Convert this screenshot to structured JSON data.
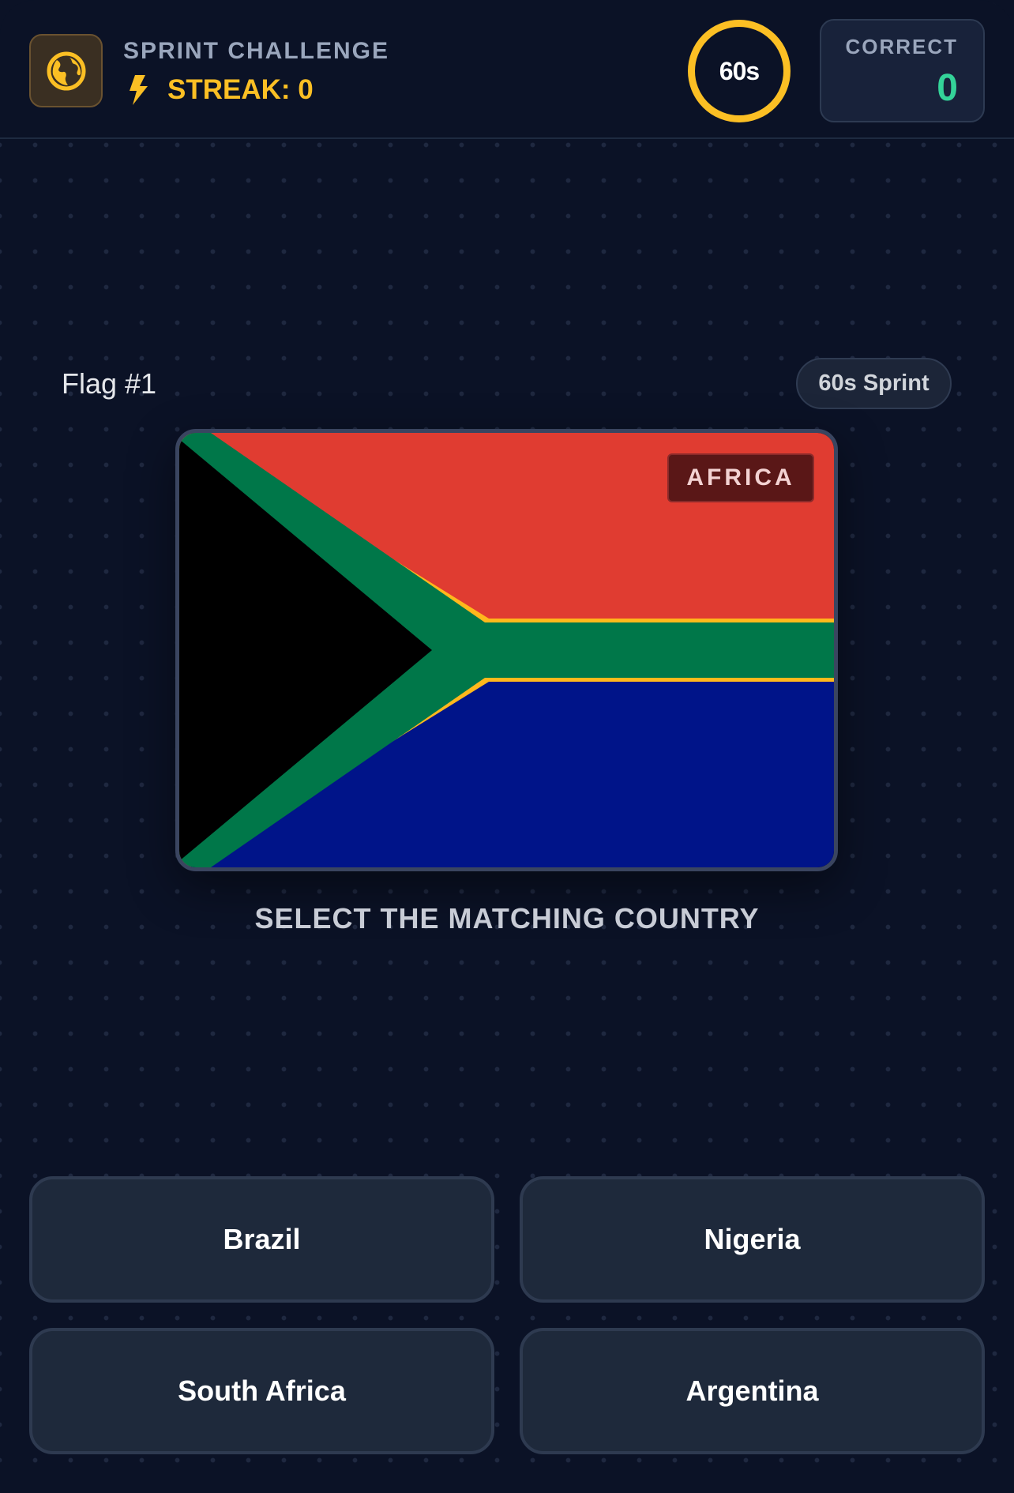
{
  "header": {
    "mode_title": "SPRINT CHALLENGE",
    "streak_label": "STREAK: 0",
    "timer": "60s",
    "score_label": "CORRECT",
    "score_value": "0"
  },
  "question": {
    "flag_number": "Flag #1",
    "mode_badge": "60s Sprint",
    "region": "AFRICA",
    "prompt": "SELECT THE MATCHING COUNTRY"
  },
  "answers": [
    {
      "label": "Brazil"
    },
    {
      "label": "Nigeria"
    },
    {
      "label": "South Africa"
    },
    {
      "label": "Argentina"
    }
  ],
  "colors": {
    "accent": "#fbbf24",
    "correct": "#34d399",
    "background": "#0b1226",
    "flag_red": "#e03c31",
    "flag_green": "#007749",
    "flag_blue": "#001489",
    "flag_gold": "#ffb81c",
    "flag_black": "#000000"
  },
  "icons": {
    "mode": "globe-icon",
    "streak": "lightning-icon"
  }
}
